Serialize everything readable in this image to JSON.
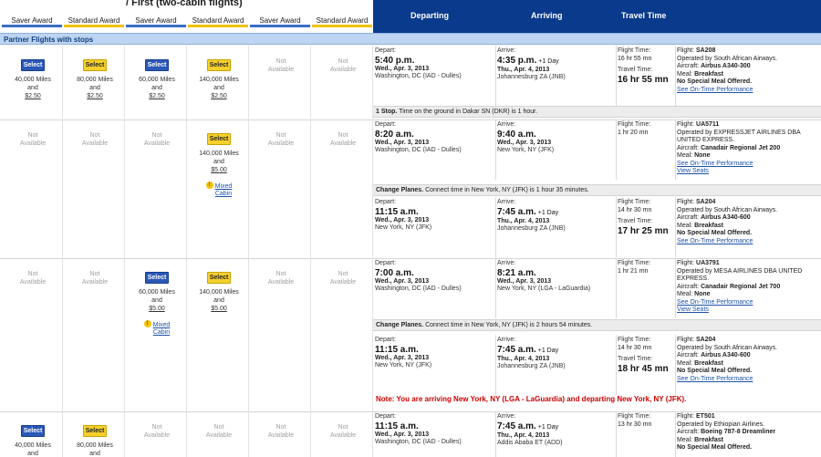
{
  "header": {
    "group_title": "/ First (two-cabin flights)",
    "awards": [
      "Saver Award",
      "Standard Award",
      "Saver Award",
      "Standard Award",
      "Saver Award",
      "Standard Award"
    ],
    "columns": [
      "Departing",
      "Arriving",
      "Travel Time"
    ]
  },
  "section_title": "Partner Flights with stops",
  "ui_text": {
    "select": "Select",
    "not": "Not",
    "available": "Available",
    "and": "and",
    "depart": "Depart:",
    "arrive": "Arrive:",
    "flight_time": "Flight Time:",
    "travel_time": "Travel Time:",
    "flight": "Flight:",
    "aircraft": "Aircraft:",
    "meal": "Meal:",
    "on_time": "See On-Time Performance",
    "view_seats": "View Seats",
    "mixed1": "Mixed",
    "mixed2": "Cabin",
    "warn_glyph": "!",
    "change_planes": "Change Planes.",
    "one_stop": "1 Stop."
  },
  "colors": {
    "blue_header": "#0a3a8c",
    "partner_bar": "#bdd4f2",
    "saver": "#3b6fc4",
    "standard": "#f3c300",
    "note": "#cc0000"
  },
  "options": [
    {
      "fares": [
        {
          "miles": "40,000 Miles",
          "fee": "$2.50",
          "btn": "blue"
        },
        {
          "miles": "80,000 Miles",
          "fee": "$2.50",
          "btn": "yel"
        },
        {
          "miles": "60,000 Miles",
          "fee": "$2.50",
          "btn": "blue"
        },
        {
          "miles": "140,000 Miles",
          "fee": "$2.50",
          "btn": "yel"
        },
        null,
        null
      ],
      "segments": [
        {
          "dep_time": "5:40 p.m.",
          "dep_date": "Wed., Apr. 3, 2013",
          "dep_city": "Washington, DC (IAD - Dulles)",
          "arr_time": "4:35 p.m.",
          "arr_plus": "+1 Day",
          "arr_date": "Thu., Apr. 4, 2013",
          "arr_city": "Johannesburg ZA (JNB)",
          "flight_time": "16 hr 55 mn",
          "travel_time": "16 hr 55 mn",
          "flight": "SA208",
          "operated": "Operated by South African Airways.",
          "aircraft": "Airbus A340-300",
          "meal": "Breakfast",
          "special": "No Special Meal Offered.",
          "links": [
            "on_time"
          ]
        }
      ],
      "stop_bar": {
        "label": "1 Stop.",
        "text": "Time on the ground in Dakar SN (DKR) is 1 hour."
      }
    },
    {
      "fares": [
        null,
        null,
        null,
        {
          "miles": "140,000 Miles",
          "fee": "$5.00",
          "btn": "yel",
          "mixed": true
        },
        null,
        null
      ],
      "segments": [
        {
          "dep_time": "8:20 a.m.",
          "dep_date": "Wed., Apr. 3, 2013",
          "dep_city": "Washington, DC (IAD - Dulles)",
          "arr_time": "9:40 a.m.",
          "arr_plus": "",
          "arr_date": "Wed., Apr. 3, 2013",
          "arr_city": "New York, NY (JFK)",
          "flight_time": "1 hr 20 mn",
          "travel_time": "",
          "flight": "UA5711",
          "operated": "Operated by EXPRESSJET AIRLINES DBA UNITED EXPRESS.",
          "aircraft": "Canadair Regional Jet 200",
          "meal": "None",
          "special": "",
          "links": [
            "on_time",
            "view_seats"
          ]
        },
        {
          "dep_time": "11:15 a.m.",
          "dep_date": "Wed., Apr. 3, 2013",
          "dep_city": "New York, NY (JFK)",
          "arr_time": "7:45 a.m.",
          "arr_plus": "+1 Day",
          "arr_date": "Thu., Apr. 4, 2013",
          "arr_city": "Johannesburg ZA (JNB)",
          "flight_time": "14 hr 30 mn",
          "travel_time": "17 hr 25 mn",
          "flight": "SA204",
          "operated": "Operated by South African Airways.",
          "aircraft": "Airbus A340-600",
          "meal": "Breakfast",
          "special": "No Special Meal Offered.",
          "links": [
            "on_time"
          ]
        }
      ],
      "change_bar": {
        "label": "Change Planes.",
        "text": "Connect time in New York, NY (JFK) is 1 hour 35 minutes."
      }
    },
    {
      "fares": [
        null,
        null,
        {
          "miles": "60,000 Miles",
          "fee": "$5.00",
          "btn": "blue",
          "mixed": true
        },
        {
          "miles": "140,000 Miles",
          "fee": "$5.00",
          "btn": "yel"
        },
        null,
        null
      ],
      "segments": [
        {
          "dep_time": "7:00 a.m.",
          "dep_date": "Wed., Apr. 3, 2013",
          "dep_city": "Washington, DC (IAD - Dulles)",
          "arr_time": "8:21 a.m.",
          "arr_plus": "",
          "arr_date": "Wed., Apr. 3, 2013",
          "arr_city": "New York, NY (LGA - LaGuardia)",
          "flight_time": "1 hr 21 mn",
          "travel_time": "",
          "flight": "UA3791",
          "operated": "Operated by MESA AIRLINES DBA UNITED EXPRESS.",
          "aircraft": "Canadair Regional Jet 700",
          "meal": "None",
          "special": "",
          "links": [
            "on_time",
            "view_seats"
          ]
        },
        {
          "dep_time": "11:15 a.m.",
          "dep_date": "Wed., Apr. 3, 2013",
          "dep_city": "New York, NY (JFK)",
          "arr_time": "7:45 a.m.",
          "arr_plus": "+1 Day",
          "arr_date": "Thu., Apr. 4, 2013",
          "arr_city": "Johannesburg ZA (JNB)",
          "flight_time": "14 hr 30 mn",
          "travel_time": "18 hr 45 mn",
          "flight": "SA204",
          "operated": "Operated by South African Airways.",
          "aircraft": "Airbus A340-600",
          "meal": "Breakfast",
          "special": "No Special Meal Offered.",
          "links": [
            "on_time"
          ]
        }
      ],
      "change_bar": {
        "label": "Change Planes.",
        "text": "Connect time in New York, NY (JFK) is 2 hours 54 minutes."
      },
      "note": "Note: You are arriving New York, NY (LGA - LaGuardia) and departing New York, NY (JFK)."
    },
    {
      "fares": [
        {
          "miles": "40,000 Miles",
          "fee": "$2.50",
          "btn": "blue"
        },
        {
          "miles": "80,000 Miles",
          "fee": "$2.50",
          "btn": "yel"
        },
        null,
        null,
        null,
        null
      ],
      "segments": [
        {
          "dep_time": "11:15 a.m.",
          "dep_date": "Wed., Apr. 3, 2013",
          "dep_city": "Washington, DC (IAD - Dulles)",
          "arr_time": "7:45 a.m.",
          "arr_plus": "+1 Day",
          "arr_date": "Thu., Apr. 4, 2013",
          "arr_city": "Addis Ababa ET (ADD)",
          "flight_time": "13 hr 30 mn",
          "travel_time": "",
          "flight": "ET501",
          "operated": "Operated by Ethiopian Airlines.",
          "aircraft": "Boeing 787-8 Dreamliner",
          "meal": "Breakfast",
          "special": "No Special Meal Offered.",
          "links": []
        }
      ]
    }
  ]
}
